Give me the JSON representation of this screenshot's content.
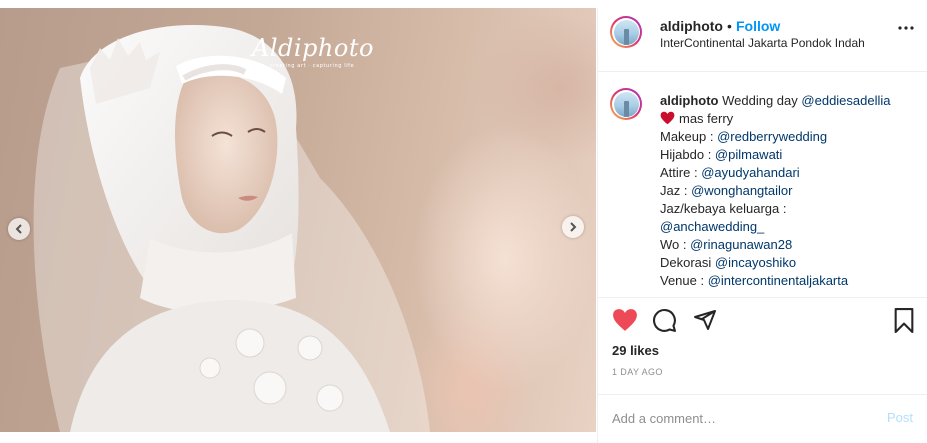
{
  "post": {
    "photo": {
      "watermark_title": "Aldiphoto",
      "watermark_subtitle": "creating art · capturing life"
    },
    "header": {
      "username": "aldiphoto",
      "separator": "•",
      "follow_label": "Follow",
      "location": "InterContinental Jakarta Pondok Indah"
    },
    "caption": {
      "username": "aldiphoto",
      "line1_text": "Wedding day",
      "line1_mention": "@eddiesadellia",
      "line2_text": "mas ferry",
      "credits": [
        {
          "label": "Makeup : ",
          "mention": "@redberrywedding"
        },
        {
          "label": "Hijabdo : ",
          "mention": "@pilmawati"
        },
        {
          "label": "Attire : ",
          "mention": "@ayudyahandari"
        },
        {
          "label": "Jaz : ",
          "mention": "@wonghangtailor"
        },
        {
          "label": "Jaz/kebaya keluarga :",
          "mention": ""
        },
        {
          "label": "",
          "mention": "@anchawedding_"
        },
        {
          "label": "Wo : ",
          "mention": "@rinagunawan28"
        },
        {
          "label": "Dekorasi ",
          "mention": "@incayoshiko"
        },
        {
          "label": "Venue : ",
          "mention": "@intercontinentaljakarta"
        }
      ]
    },
    "likes": "29 likes",
    "timestamp": "1 DAY AGO",
    "comment": {
      "placeholder": "Add a comment…",
      "post_label": "Post"
    },
    "colors": {
      "accent": "#0095f6",
      "like_red": "#ed4956",
      "mention": "#00376b",
      "muted": "#8e8e8e"
    },
    "icons": [
      "chevron-left-icon",
      "chevron-right-icon",
      "more-icon",
      "heart-icon",
      "comment-icon",
      "share-icon",
      "bookmark-icon",
      "heart-emoji-icon"
    ]
  }
}
